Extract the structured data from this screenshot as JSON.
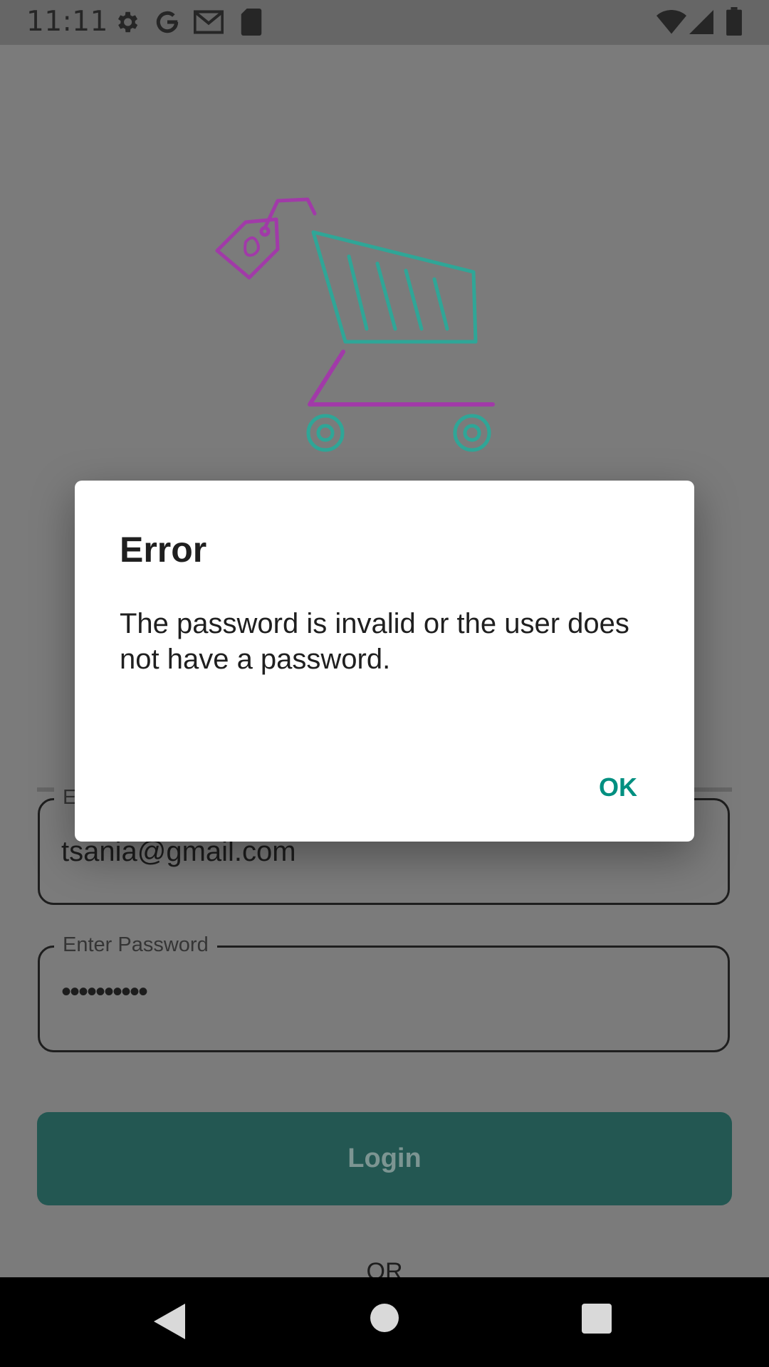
{
  "status_bar": {
    "time": "11:11"
  },
  "login_form": {
    "email_label": "Enter Email",
    "email_value": "tsania@gmail.com",
    "password_label": "Enter Password",
    "password_value": "••••••••••",
    "login_label": "Login",
    "or_label": "OR"
  },
  "dialog": {
    "title": "Error",
    "message": "The password is invalid or the user does not have a password.",
    "ok_label": "OK"
  },
  "colors": {
    "accent": "#008f80",
    "button": "#235752",
    "logo_magenta": "#a13aa8",
    "logo_teal": "#2fa697"
  }
}
